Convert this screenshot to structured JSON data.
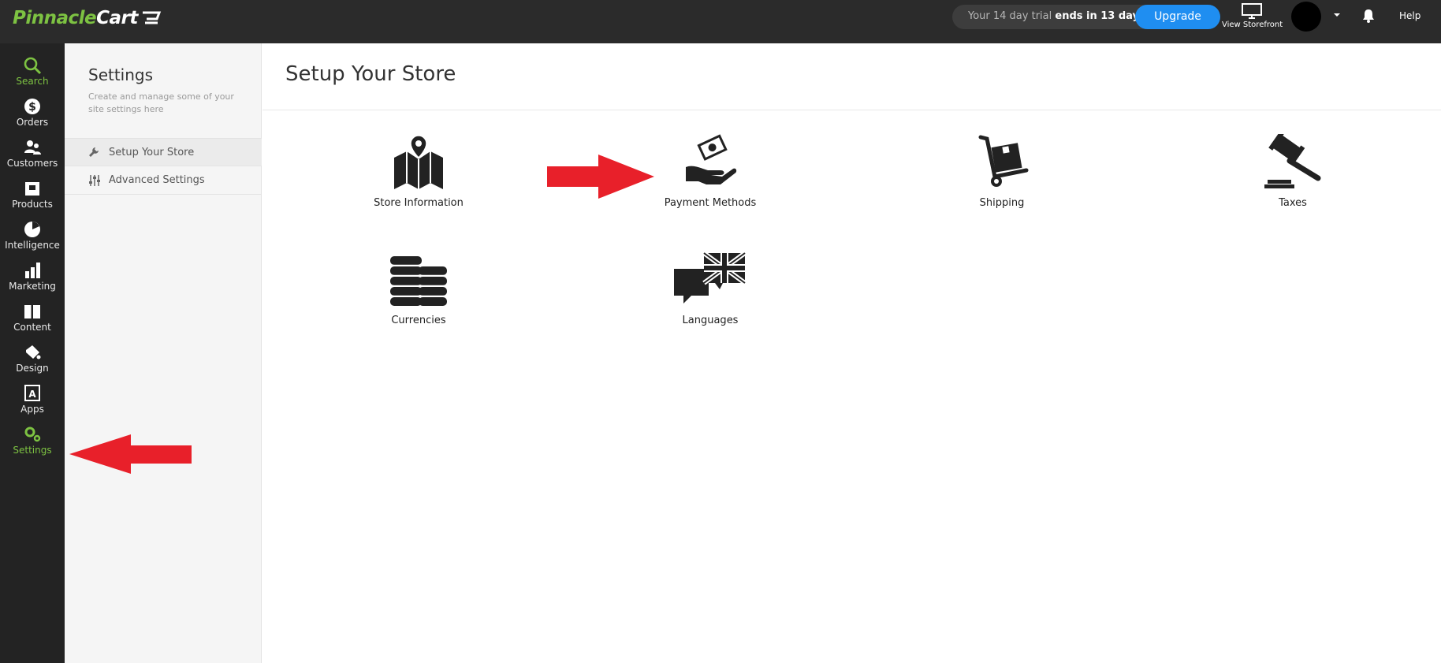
{
  "topbar": {
    "logo_text_1": "Pinnacle",
    "logo_text_2": "Cart",
    "trial_prefix": "Your 14 day trial ",
    "trial_emphasis": "ends in 13 days",
    "upgrade_label": "Upgrade",
    "view_storefront_label": "View Storefront",
    "help_label": "Help"
  },
  "leftnav": {
    "items": [
      {
        "label": "Search",
        "icon": "search-icon",
        "active": true
      },
      {
        "label": "Orders",
        "icon": "dollar-icon"
      },
      {
        "label": "Customers",
        "icon": "users-icon"
      },
      {
        "label": "Products",
        "icon": "products-icon"
      },
      {
        "label": "Intelligence",
        "icon": "pie-chart-icon"
      },
      {
        "label": "Marketing",
        "icon": "bar-chart-icon"
      },
      {
        "label": "Content",
        "icon": "book-icon"
      },
      {
        "label": "Design",
        "icon": "paint-bucket-icon"
      },
      {
        "label": "Apps",
        "icon": "apps-icon"
      },
      {
        "label": "Settings",
        "icon": "gears-icon",
        "active": true
      }
    ]
  },
  "settings_panel": {
    "title": "Settings",
    "description": "Create and manage some of your site settings here",
    "items": [
      {
        "label": "Setup Your Store",
        "icon": "wrench-icon",
        "active": true
      },
      {
        "label": "Advanced Settings",
        "icon": "sliders-icon"
      }
    ]
  },
  "main": {
    "title": "Setup Your Store",
    "tiles": [
      {
        "label": "Store Information",
        "icon": "map-pin-icon"
      },
      {
        "label": "Payment Methods",
        "icon": "money-hand-icon"
      },
      {
        "label": "Shipping",
        "icon": "hand-truck-icon"
      },
      {
        "label": "Taxes",
        "icon": "gavel-icon"
      },
      {
        "label": "Currencies",
        "icon": "coin-stacks-icon"
      },
      {
        "label": "Languages",
        "icon": "speech-flag-icon"
      }
    ]
  },
  "colors": {
    "brand_green": "#7dc242",
    "upgrade_blue": "#1f8ef1",
    "annotation_red": "#e8202a",
    "topbar_bg": "#2b2b2b",
    "nav_bg": "#232323"
  }
}
